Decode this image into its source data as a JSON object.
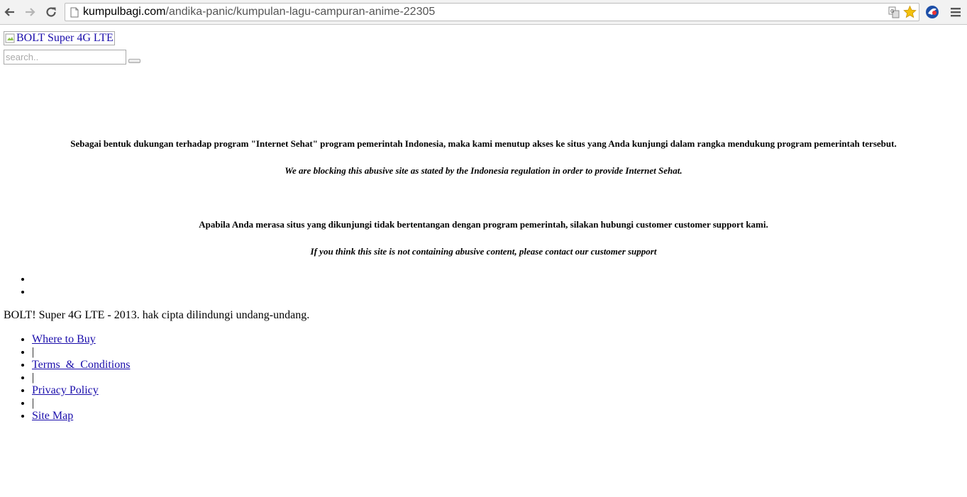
{
  "browser": {
    "url_host": "kumpulbagi.com",
    "url_path": "/andika-panic/kumpulan-lagu-campuran-anime-22305"
  },
  "header": {
    "logo_alt": "BOLT Super 4G LTE",
    "search": {
      "placeholder": "search..",
      "value": ""
    }
  },
  "notice": {
    "line1": "Sebagai bentuk dukungan terhadap program \"Internet Sehat\" program pemerintah Indonesia, maka kami menutup akses ke situs yang Anda kunjungi dalam rangka mendukung program pemerintah tersebut.",
    "line2": "We are blocking this abusive site as stated by the Indonesia regulation in order to provide Internet Sehat.",
    "line3": "Apabila Anda merasa situs yang dikunjungi tidak bertentangan dengan program pemerintah, silakan hubungi customer customer support kami.",
    "line4": "If you think this site is not containing abusive content, please contact our customer support"
  },
  "footer": {
    "copyright": "BOLT! Super 4G LTE - 2013. hak cipta dilindungi undang-undang.",
    "links": {
      "where_to_buy": "Where to Buy",
      "sep1": "|",
      "terms": "Terms  &  Conditions",
      "sep2": "|",
      "privacy": "Privacy Policy",
      "sep3": "|",
      "sitemap": "Site Map"
    }
  },
  "icons": {
    "back": "back-arrow-icon",
    "forward": "forward-arrow-icon",
    "reload": "reload-icon",
    "page": "page-icon",
    "translate": "translate-icon",
    "bookmark": "star-icon",
    "extension": "extension-icon",
    "menu": "hamburger-menu-icon"
  },
  "colors": {
    "link": "#1a0dab",
    "bookmark_star": "#f4c20d"
  }
}
